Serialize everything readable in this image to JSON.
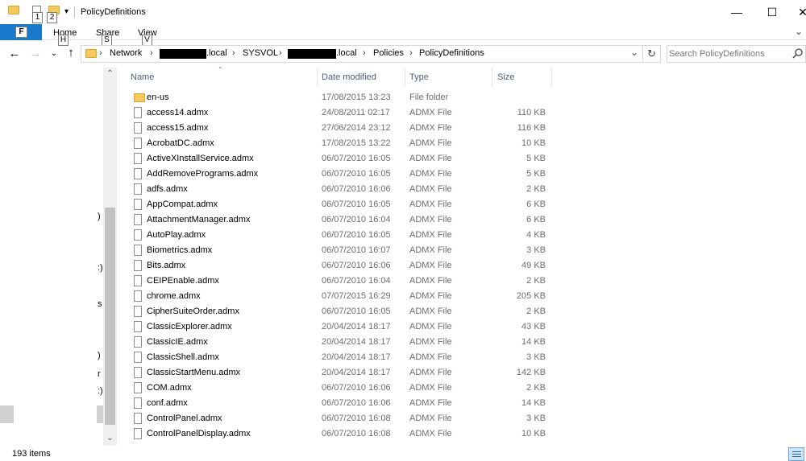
{
  "window": {
    "title": "PolicyDefinitions",
    "minimize": "—",
    "maximize": "☐",
    "close": "✕",
    "ribbon_expand": "⌄"
  },
  "quick_access": {
    "keytip_1": "1",
    "keytip_2": "2",
    "dropdown": "▾"
  },
  "ribbon": {
    "file_key": "F",
    "tabs": [
      {
        "label": "Home",
        "key": "H"
      },
      {
        "label": "Share",
        "key": "S"
      },
      {
        "label": "View",
        "key": "V"
      }
    ]
  },
  "address": {
    "crumbs": [
      "Network",
      ".local",
      "SYSVOL",
      ".local",
      "Policies",
      "PolicyDefinitions"
    ],
    "sep": "›",
    "dropdown": "⌄",
    "refresh": "↻"
  },
  "nav_buttons": {
    "back": "←",
    "forward": "→",
    "recent": "⌄",
    "up": "↑"
  },
  "search": {
    "placeholder": "Search PolicyDefinitions"
  },
  "nav_pane": {
    "scroll_up": "⌃",
    "scroll_down": "⌄",
    "fragments": [
      ")",
      ":)",
      "s",
      ")",
      "r",
      ":)"
    ]
  },
  "columns": {
    "name": "Name",
    "date": "Date modified",
    "type": "Type",
    "size": "Size",
    "sort_indicator": "⌃"
  },
  "files": [
    {
      "name": "en-us",
      "date": "17/08/2015 13:23",
      "type": "File folder",
      "size": "",
      "kind": "folder"
    },
    {
      "name": "access14.admx",
      "date": "24/08/2011 02:17",
      "type": "ADMX File",
      "size": "110 KB",
      "kind": "file"
    },
    {
      "name": "access15.admx",
      "date": "27/06/2014 23:12",
      "type": "ADMX File",
      "size": "116 KB",
      "kind": "file"
    },
    {
      "name": "AcrobatDC.admx",
      "date": "17/08/2015 13:22",
      "type": "ADMX File",
      "size": "10 KB",
      "kind": "file"
    },
    {
      "name": "ActiveXInstallService.admx",
      "date": "06/07/2010 16:05",
      "type": "ADMX File",
      "size": "5 KB",
      "kind": "file"
    },
    {
      "name": "AddRemovePrograms.admx",
      "date": "06/07/2010 16:05",
      "type": "ADMX File",
      "size": "5 KB",
      "kind": "file"
    },
    {
      "name": "adfs.admx",
      "date": "06/07/2010 16:06",
      "type": "ADMX File",
      "size": "2 KB",
      "kind": "file"
    },
    {
      "name": "AppCompat.admx",
      "date": "06/07/2010 16:05",
      "type": "ADMX File",
      "size": "6 KB",
      "kind": "file"
    },
    {
      "name": "AttachmentManager.admx",
      "date": "06/07/2010 16:04",
      "type": "ADMX File",
      "size": "6 KB",
      "kind": "file"
    },
    {
      "name": "AutoPlay.admx",
      "date": "06/07/2010 16:05",
      "type": "ADMX File",
      "size": "4 KB",
      "kind": "file"
    },
    {
      "name": "Biometrics.admx",
      "date": "06/07/2010 16:07",
      "type": "ADMX File",
      "size": "3 KB",
      "kind": "file"
    },
    {
      "name": "Bits.admx",
      "date": "06/07/2010 16:06",
      "type": "ADMX File",
      "size": "49 KB",
      "kind": "file"
    },
    {
      "name": "CEIPEnable.admx",
      "date": "06/07/2010 16:04",
      "type": "ADMX File",
      "size": "2 KB",
      "kind": "file"
    },
    {
      "name": "chrome.admx",
      "date": "07/07/2015 16:29",
      "type": "ADMX File",
      "size": "205 KB",
      "kind": "file"
    },
    {
      "name": "CipherSuiteOrder.admx",
      "date": "06/07/2010 16:05",
      "type": "ADMX File",
      "size": "2 KB",
      "kind": "file"
    },
    {
      "name": "ClassicExplorer.admx",
      "date": "20/04/2014 18:17",
      "type": "ADMX File",
      "size": "43 KB",
      "kind": "file"
    },
    {
      "name": "ClassicIE.admx",
      "date": "20/04/2014 18:17",
      "type": "ADMX File",
      "size": "14 KB",
      "kind": "file"
    },
    {
      "name": "ClassicShell.admx",
      "date": "20/04/2014 18:17",
      "type": "ADMX File",
      "size": "3 KB",
      "kind": "file"
    },
    {
      "name": "ClassicStartMenu.admx",
      "date": "20/04/2014 18:17",
      "type": "ADMX File",
      "size": "142 KB",
      "kind": "file"
    },
    {
      "name": "COM.admx",
      "date": "06/07/2010 16:06",
      "type": "ADMX File",
      "size": "2 KB",
      "kind": "file"
    },
    {
      "name": "conf.admx",
      "date": "06/07/2010 16:06",
      "type": "ADMX File",
      "size": "14 KB",
      "kind": "file"
    },
    {
      "name": "ControlPanel.admx",
      "date": "06/07/2010 16:08",
      "type": "ADMX File",
      "size": "3 KB",
      "kind": "file"
    },
    {
      "name": "ControlPanelDisplay.admx",
      "date": "06/07/2010 16:08",
      "type": "ADMX File",
      "size": "10 KB",
      "kind": "file"
    }
  ],
  "status": {
    "item_count": "193 items"
  },
  "colors": {
    "file_tab": "#1979ca",
    "header_text": "#4c607a",
    "secondary_text": "#6d6d6d"
  }
}
